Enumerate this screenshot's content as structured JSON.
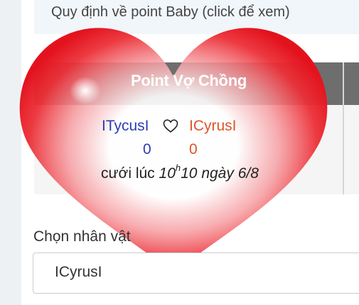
{
  "notice": {
    "text": "Quy định về point Baby (click để xem)"
  },
  "card": {
    "title": "Point Vợ Chồng",
    "player1": {
      "name": "ITycusI",
      "score": "0"
    },
    "player2": {
      "name": "ICyrusI",
      "score": "0"
    },
    "wedding_label": "cưới lúc",
    "wedding_hour": "10",
    "wedding_hour_sup": "h",
    "wedding_rest": "10 ngày 6/8"
  },
  "character_select": {
    "label": "Chọn nhân vật",
    "value": "ICyrusI"
  },
  "colors": {
    "player1": "#2c3cb8",
    "player2": "#e0532a",
    "heart": "#e8202a",
    "header": "#6e6e6e"
  },
  "icons": [
    "heart-outline-icon",
    "heart-overlay-image"
  ]
}
